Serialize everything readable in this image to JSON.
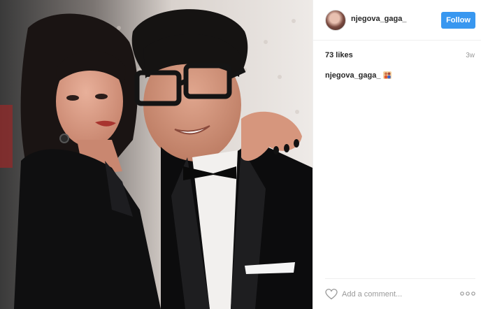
{
  "post": {
    "image_alt": "Woman and man in black suit with glasses posing together"
  },
  "header": {
    "username": "njegova_gaga_",
    "follow_label": "Follow"
  },
  "meta": {
    "likes": "73 likes",
    "time": "3w"
  },
  "caption": {
    "username": "njegova_gaga_",
    "emoji": "couple-emoji"
  },
  "footer": {
    "comment_placeholder": "Add a comment..."
  },
  "icons": {
    "like": "heart-outline-icon",
    "more": "more-options-icon"
  },
  "colors": {
    "follow_button": "#3897f0",
    "text": "#262626",
    "muted": "#999999",
    "border": "#efefef"
  }
}
